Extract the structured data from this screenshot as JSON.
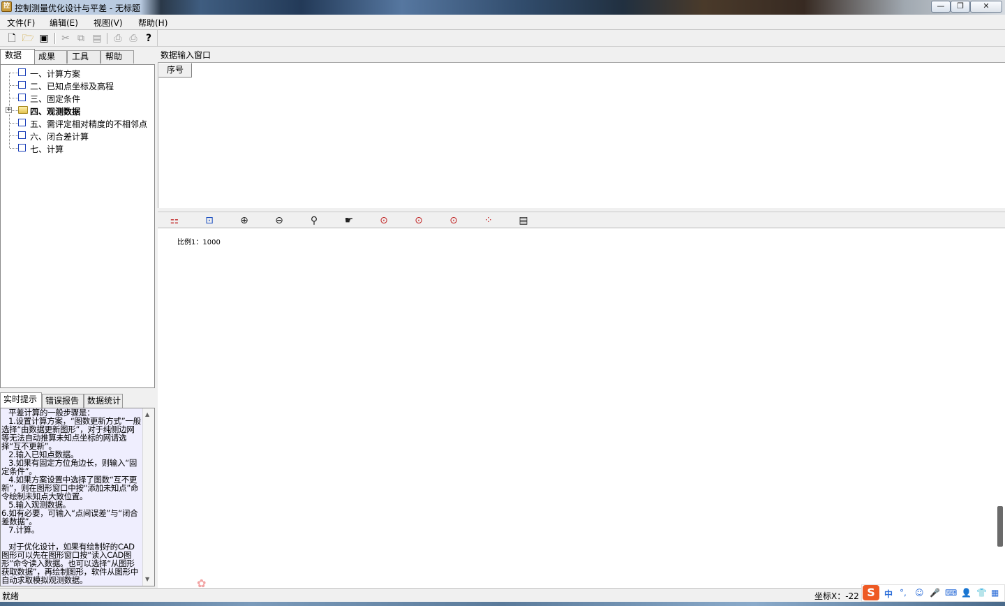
{
  "window": {
    "title": "控制测量优化设计与平差 - 无标题",
    "minimize": "—",
    "maximize": "❐",
    "close": "✕"
  },
  "menu": [
    {
      "label": "文件(F)"
    },
    {
      "label": "编辑(E)"
    },
    {
      "label": "视图(V)"
    },
    {
      "label": "帮助(H)"
    }
  ],
  "toolbar": {
    "icons": [
      "new-icon",
      "open-icon",
      "save-icon",
      "cut-icon",
      "copy-icon",
      "paste-icon",
      "print-preview-icon",
      "print-icon",
      "help-icon"
    ]
  },
  "left_tabs": [
    {
      "label": "数据",
      "active": true
    },
    {
      "label": "成果",
      "active": false
    },
    {
      "label": "工具",
      "active": false
    },
    {
      "label": "帮助",
      "active": false
    }
  ],
  "tree": [
    {
      "label": "一、计算方案"
    },
    {
      "label": "二、已知点坐标及高程"
    },
    {
      "label": "三、固定条件"
    },
    {
      "label": "四、观测数据",
      "bold": true,
      "folder": true,
      "expander": "+"
    },
    {
      "label": "五、需评定相对精度的不相邻点"
    },
    {
      "label": "六、闭合差计算"
    },
    {
      "label": "七、计算"
    }
  ],
  "hint_tabs": [
    {
      "label": "实时提示",
      "active": true
    },
    {
      "label": "错误报告",
      "active": false
    },
    {
      "label": "数据统计",
      "active": false
    }
  ],
  "hint_text": "   平差计算的一般步骤是：\n   1.设置计算方案，“图数更新方式”一般选择“由数据更新图形”，对于纯侧边网等无法自动推算未知点坐标的网请选择“互不更新”。\n   2.输入已知点数据。\n   3.如果有固定方位角边长，则输入“固定条件”。\n   4.如果方案设置中选择了图数“互不更新”，则在图形窗口中按“添加未知点”命令绘制未知点大致位置。\n   5.输入观测数据。\n6.如有必要，可输入“点间误差”与“闭合差数据”。\n   7.计算。\n\n   对于优化设计，如果有绘制好的CAD图形可以先在图形窗口按“读入CAD图形”命令读入数据。也可以选择“从图形获取数据”，再绘制图形，软件从图形中自动求取模拟观测数据。",
  "input_window": {
    "title": "数据输入窗口",
    "column_header": "序号"
  },
  "graph_toolbar": {
    "icons": [
      "layer-icon",
      "select-icon",
      "zoom-in-icon",
      "zoom-out-icon",
      "zoom-dynamic-icon",
      "pan-icon",
      "add-point-icon",
      "delete-point-icon",
      "move-point-icon",
      "network-icon",
      "properties-icon"
    ]
  },
  "graph": {
    "scale_label": "比例1：1000"
  },
  "status": {
    "text": "就绪",
    "coord": "坐标X：-22"
  },
  "ime": {
    "logo": "S",
    "lang": "中"
  }
}
